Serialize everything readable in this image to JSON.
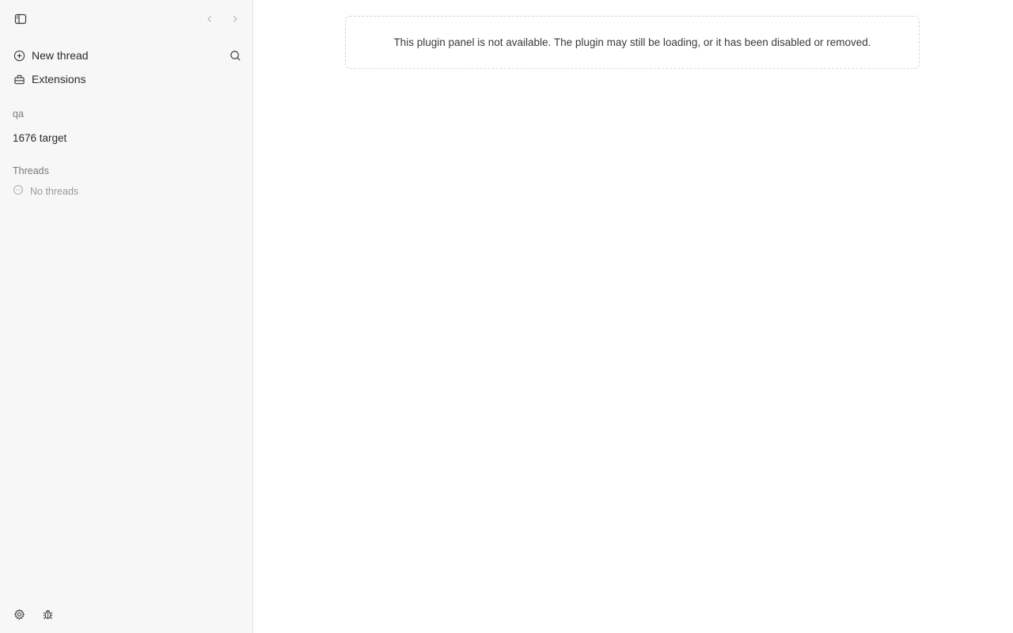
{
  "sidebar": {
    "toggle_icon": "sidebar-toggle-icon",
    "back_icon": "chevron-left-icon",
    "forward_icon": "chevron-right-icon",
    "new_thread_label": "New thread",
    "search_icon": "search-icon",
    "extensions_label": "Extensions",
    "workspace_label": "qa",
    "project_label": "1676 target",
    "threads_section_label": "Threads",
    "no_threads_label": "No threads",
    "settings_icon": "gear-icon",
    "debug_icon": "bug-icon"
  },
  "main": {
    "notice_text": "This plugin panel is not available. The plugin may still be loading, or it has been disabled or removed."
  }
}
